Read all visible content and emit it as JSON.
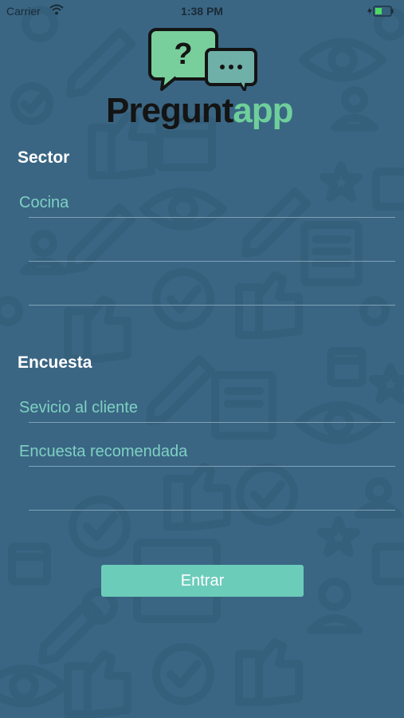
{
  "status_bar": {
    "carrier": "Carrier",
    "time": "1:38 PM"
  },
  "logo": {
    "text_part1": "Pregunt",
    "text_part2": "app",
    "bubble_symbol": "?",
    "bubble2_symbol": "···"
  },
  "sector": {
    "title": "Sector",
    "options": [
      "Cocina",
      "",
      ""
    ]
  },
  "encuesta": {
    "title": "Encuesta",
    "options": [
      "Sevicio al cliente",
      "Encuesta recomendada",
      ""
    ]
  },
  "button": {
    "label": "Entrar"
  },
  "colors": {
    "background": "#3a6684",
    "accent": "#6cccba",
    "field_text": "#7fd0c2"
  }
}
